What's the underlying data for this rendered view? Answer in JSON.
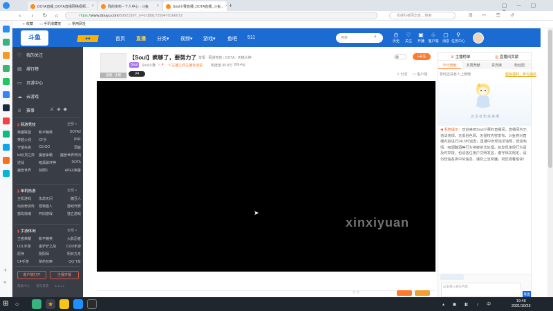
{
  "browser": {
    "tabs": [
      {
        "title": "DOTA直播_DOTA直播网络视频..."
      },
      {
        "title": "我的资料 - 个人中心 - 斗鱼"
      },
      {
        "title": "Soul小赛直播_DOTA直播_斗鱼..."
      }
    ],
    "url_prefix": "https://",
    "url_host": "www.douyu.com",
    "url_path": "/5062199?_rr=0.08917250470166072",
    "search_placeholder": "张继科被网恋盲... 搜索",
    "bookmarks": [
      "收藏",
      "手机收藏夹",
      "常用网址"
    ]
  },
  "site": {
    "logo_text": "斗鱼",
    "nav": [
      "首页",
      "直播",
      "分类▾",
      "视频▾",
      "游戏▾",
      "鱼吧",
      "511"
    ],
    "active_nav": "直播",
    "header_search_placeholder": "搜索",
    "header_icons": [
      {
        "icon": "history-icon",
        "label": "历史"
      },
      {
        "icon": "heart-icon",
        "label": "关注"
      },
      {
        "icon": "video-icon",
        "label": "开播"
      },
      {
        "icon": "gift-icon",
        "label": "客户端"
      },
      {
        "icon": "message-icon",
        "label": "消息"
      },
      {
        "icon": "location-icon",
        "label": "任务中心"
      }
    ]
  },
  "sidebar": {
    "items": [
      {
        "icon": "heart-icon",
        "label": "我的关注"
      },
      {
        "icon": "rank-icon",
        "label": "排行榜"
      },
      {
        "icon": "page-icon",
        "label": "页游中心"
      },
      {
        "icon": "cloud-icon",
        "label": "云游戏"
      },
      {
        "icon": "trophy-icon",
        "label": "赛事"
      }
    ],
    "sections": [
      {
        "title": "网游竞技",
        "more": "全部 >",
        "games": [
          "英雄联盟",
          "和平精英",
          "DOTA2",
          "穿越火线",
          "CF手",
          "DNF",
          "守望先锋",
          "CS:GO",
          "洞庭",
          "lol云顶之弈",
          "魔兽争霸",
          "魔兽世界怀旧",
          "逆战",
          "暗黑破坏神",
          "DOTA",
          "魔兽世界",
          "剑网3",
          "APEX英雄"
        ]
      },
      {
        "title": "单机热游",
        "more": "全部 >",
        "games": [
          "主机游戏",
          "永劫无间",
          "糖豆人",
          "仙剑奇侠传",
          "怪物猎人",
          "游戏作弊",
          "孤岛惊魂",
          "怀旧游戏",
          "独立游戏"
        ]
      },
      {
        "title": "手游休闲",
        "more": "全部 >",
        "games": [
          "王者荣耀",
          "和平精英",
          "火影忍者",
          "LOL手游",
          "金铲铲之战",
          "COD手游",
          "原神",
          "阴阳师",
          "明日方舟",
          "CF手游",
          "使命召唤",
          "QQ飞车"
        ]
      }
    ],
    "buttons": [
      "客户端打开",
      "主播开播"
    ],
    "footer": [
      "帮助中心",
      "意见反馈",
      "1.1.1.1"
    ]
  },
  "room": {
    "avatar_label": "直播 · 主播",
    "title": "【Soul】疯够了，要努力了",
    "tagline": "举报 · 网游竞技 › DOTA › 天梯大神",
    "badge1": "Soul",
    "meta_parts": [
      "Soul小赛",
      "4",
      "5",
      "主播之间主播有话说",
      "热度值 95.8万",
      "999+kg"
    ],
    "v_badge": "V4",
    "follow_label": "+关注",
    "meta_right": [
      "分享",
      "客户端"
    ]
  },
  "chat": {
    "top_labels": [
      "主播榜单",
      "直播间贡献"
    ],
    "tabs": [
      "今日贡献",
      "本周贡献",
      "贵宾席",
      "粉丝团"
    ],
    "active_tab": "今日贡献",
    "notice_left": "暂时还没有人上榜哦",
    "notice_right": "超级福利，参与抽奖",
    "empty_text": "还没有粉丝来哦",
    "sys_label": "系统提示：",
    "sys_text": "欢迎来到Soul小赛的直播间，直播间内无违法违规、无低俗色情、无侵权内容发布，斗鱼将对直播内容进行24小时巡查，直播中出现违法违规、低俗色情、吸烟酗酒等行为将被依法处理。如发现违规行为请及时举报，也请各位用户文明发言，遵守相关规定，请勿轻信各类中奖信息，谨防上当受骗，祝您观看愉快！",
    "input_placeholder": "这里输入聊天内容",
    "send_label": "发送"
  },
  "watermark": "xinxiyuan",
  "taskbar": {
    "time": "19:48",
    "date": "2021/10/23"
  },
  "colors": {
    "brand_blue": "#1b6bd2",
    "accent_orange": "#ff7a2c",
    "sidebar_bg": "#393d45"
  }
}
